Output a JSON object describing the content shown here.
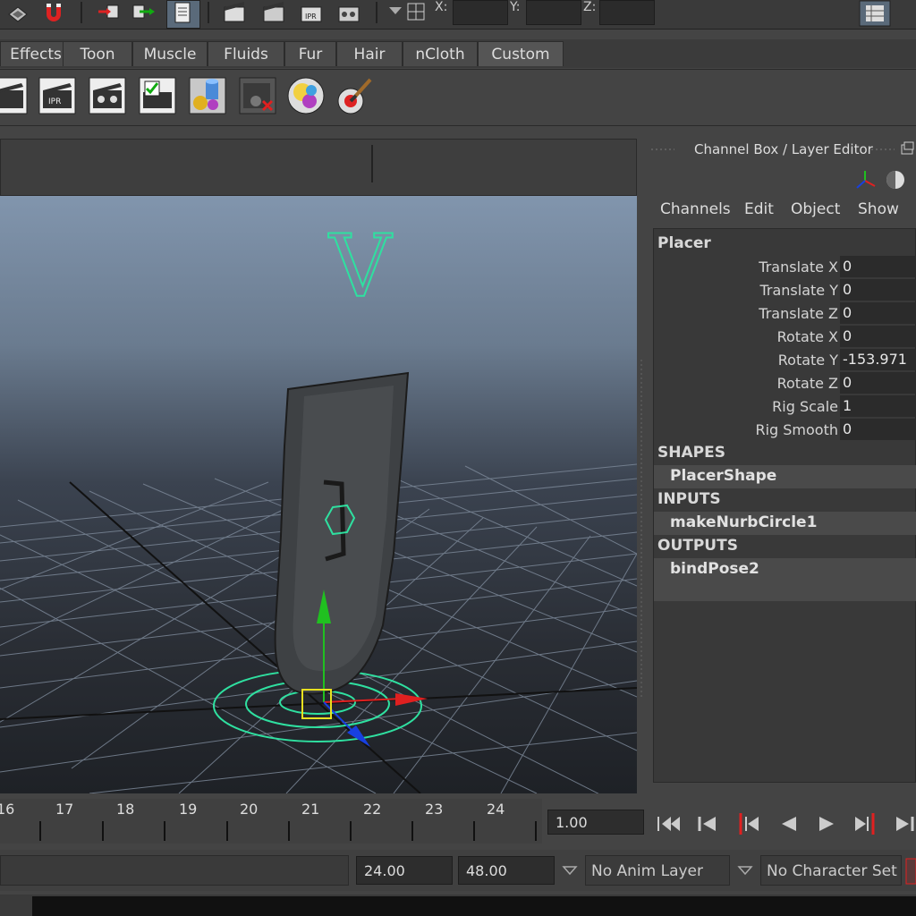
{
  "toolbar": {
    "coords": [
      {
        "label": "X:"
      },
      {
        "label": "Y:"
      },
      {
        "label": "Z:"
      }
    ]
  },
  "shelf_tabs": [
    {
      "label": "Effects"
    },
    {
      "label": "Toon"
    },
    {
      "label": "Muscle"
    },
    {
      "label": "Fluids"
    },
    {
      "label": "Fur"
    },
    {
      "label": "Hair"
    },
    {
      "label": "nCloth"
    },
    {
      "label": "Custom"
    }
  ],
  "shelf_icons": [
    "clapper-icon",
    "clapper-ipr-icon",
    "clapper-settings-icon",
    "clapper-checklist-icon",
    "render-shapes-icon",
    "render-remove-icon",
    "shader-spheres-icon",
    "paint-brush-icon"
  ],
  "channel_box": {
    "title": "Channel Box / Layer Editor",
    "menus": [
      {
        "label": "Channels"
      },
      {
        "label": "Edit"
      },
      {
        "label": "Object"
      },
      {
        "label": "Show"
      }
    ],
    "node_name": "Placer",
    "attributes": [
      {
        "label": "Translate X",
        "value": "0"
      },
      {
        "label": "Translate Y",
        "value": "0"
      },
      {
        "label": "Translate Z",
        "value": "0"
      },
      {
        "label": "Rotate X",
        "value": "0"
      },
      {
        "label": "Rotate Y",
        "value": "-153.971"
      },
      {
        "label": "Rotate Z",
        "value": "0"
      },
      {
        "label": "Rig Scale",
        "value": "1"
      },
      {
        "label": "Rig Smooth",
        "value": "0"
      }
    ],
    "shapes_header": "SHAPES",
    "shapes": [
      "PlacerShape"
    ],
    "inputs_header": "INPUTS",
    "inputs": [
      "makeNurbCircle1"
    ],
    "outputs_header": "OUTPUTS",
    "outputs": [
      "bindPose2"
    ]
  },
  "timeline": {
    "frames": [
      "16",
      "17",
      "18",
      "19",
      "20",
      "21",
      "22",
      "23",
      "24"
    ],
    "current_frame": "1.00"
  },
  "range": {
    "end_time": "24.00",
    "max_time": "48.00",
    "anim_layer": "No Anim Layer",
    "character_set": "No Character Set"
  },
  "viewport": {
    "marker_letter": "V"
  },
  "colors": {
    "accent_green": "#2fe0a0",
    "manip_red": "#e02020",
    "manip_green": "#20c020",
    "manip_blue": "#1840e0",
    "select_yellow": "#e8e020"
  }
}
